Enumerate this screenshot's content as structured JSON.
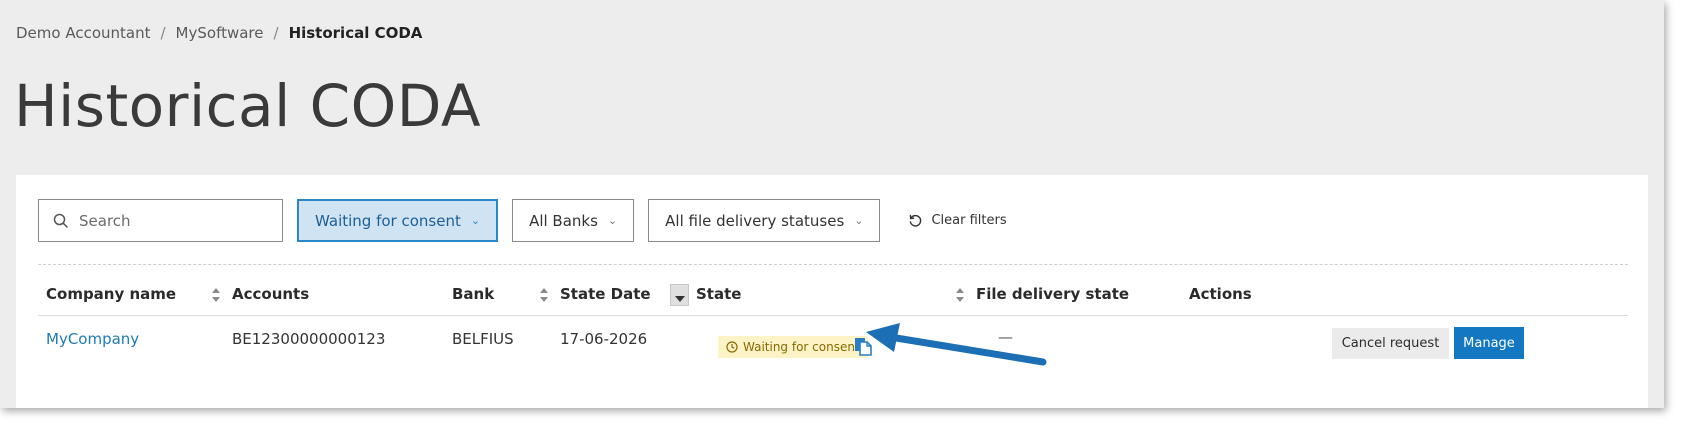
{
  "breadcrumb": {
    "items": [
      "Demo Accountant",
      "MySoftware",
      "Historical CODA"
    ],
    "separator": "/"
  },
  "page_title": "Historical CODA",
  "filters": {
    "search_placeholder": "Search",
    "state_filter": "Waiting for consent",
    "bank_filter": "All Banks",
    "delivery_filter": "All file delivery statuses",
    "clear_label": "Clear filters"
  },
  "table": {
    "columns": [
      "Company name",
      "Accounts",
      "Bank",
      "State Date",
      "State",
      "File delivery state",
      "Actions"
    ],
    "rows": [
      {
        "company": "MyCompany",
        "account": "BE12300000000123",
        "bank": "BELFIUS",
        "state_date": "17-06-2026",
        "state": "Waiting for consent",
        "file_delivery_state": "—"
      }
    ],
    "row_actions": {
      "cancel_label": "Cancel request",
      "manage_label": "Manage"
    }
  },
  "icons": [
    "search-icon",
    "chevron-down-icon",
    "refresh-icon",
    "sort-icon",
    "sort-descending-icon",
    "clock-icon",
    "copy-icon",
    "callout-arrow-icon"
  ],
  "colors": {
    "accent": "#1477c2",
    "link": "#1f7ab8",
    "active_filter_bg": "#cfe3f3",
    "badge_bg": "#fdf3c6",
    "badge_text": "#8a6a00",
    "annotation_arrow": "#1c6fb4"
  }
}
